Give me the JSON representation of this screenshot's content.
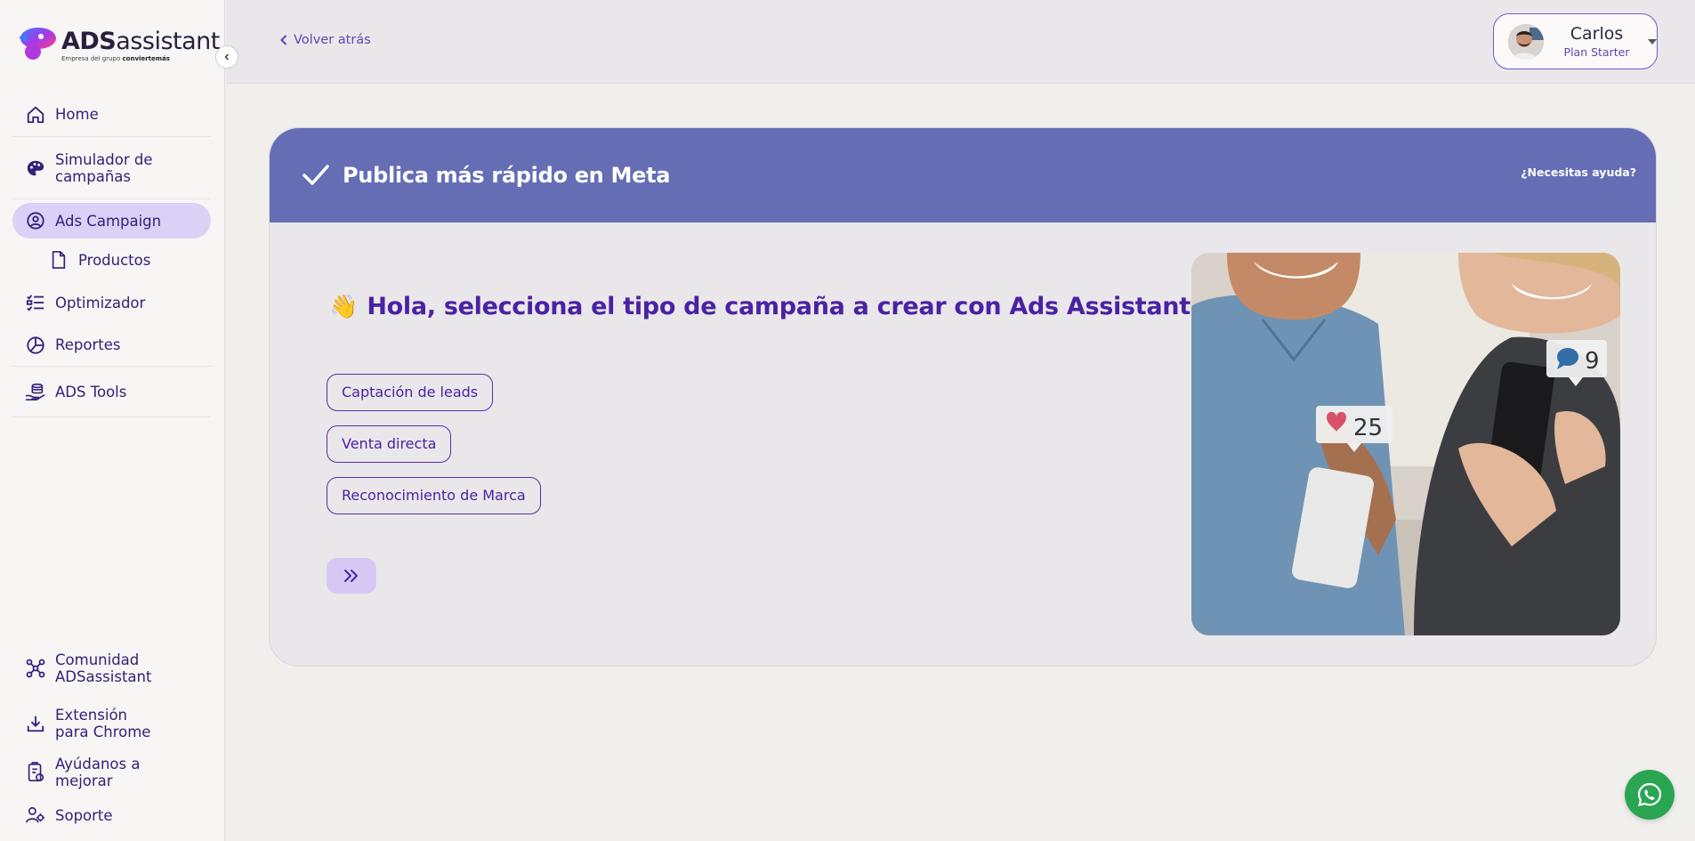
{
  "logo": {
    "brand_bold": "ADS",
    "brand_light": "assistant",
    "tagline_prefix": "Empresa del grupo",
    "tagline_brand": "conviertemás"
  },
  "sidebar": {
    "items": [
      {
        "label": "Home",
        "icon": "home-icon"
      },
      {
        "label": "Simulador de campañas",
        "icon": "palette-icon"
      },
      {
        "label": "Ads Campaign",
        "icon": "user-circle-icon",
        "active": true
      },
      {
        "label": "Productos",
        "icon": "file-icon"
      },
      {
        "label": "Optimizador",
        "icon": "checklist-icon"
      },
      {
        "label": "Reportes",
        "icon": "pie-chart-icon"
      },
      {
        "label": "ADS Tools",
        "icon": "hand-coins-icon"
      }
    ],
    "bottom_items": [
      {
        "label": "Comunidad ADSassistant",
        "icon": "community-icon"
      },
      {
        "label": "Extensión para Chrome",
        "icon": "download-icon"
      },
      {
        "label": "Ayúdanos a mejorar",
        "icon": "feedback-icon"
      },
      {
        "label": "Soporte",
        "icon": "support-icon"
      }
    ]
  },
  "header": {
    "back_label": "Volver atrás",
    "user": {
      "name": "Carlos",
      "plan": "Plan Starter"
    }
  },
  "card": {
    "title": "Publica más rápido en Meta",
    "help_label": "¿Necesitas ayuda?",
    "greeting_emoji": "👋",
    "greeting": "Hola, selecciona el tipo de campaña a crear con Ads Assistant",
    "options": [
      "Captación de leads",
      "Venta directa",
      "Reconocimiento de Marca"
    ],
    "hero_badges": {
      "likes": "25",
      "comments": "9"
    }
  },
  "colors": {
    "accent": "#656db5",
    "primary": "#4a22a3",
    "active_nav": "#d9d2f6",
    "whatsapp": "#2aa653"
  }
}
